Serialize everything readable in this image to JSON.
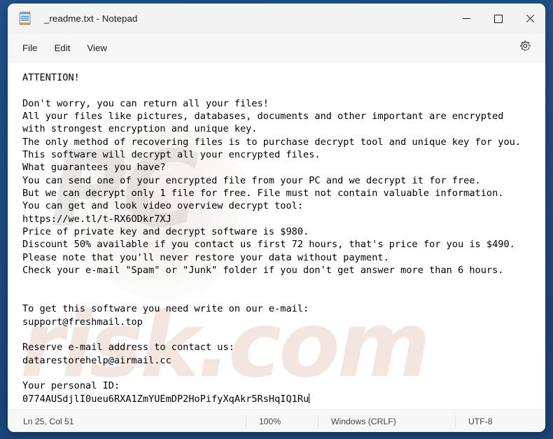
{
  "window": {
    "title": "_readme.txt - Notepad",
    "icon": "notepad-icon",
    "controls": {
      "minimize": "minimize-icon",
      "maximize": "maximize-icon",
      "close": "close-icon"
    }
  },
  "menubar": {
    "items": [
      {
        "label": "File"
      },
      {
        "label": "Edit"
      },
      {
        "label": "View"
      }
    ],
    "settings_icon": "gear-icon"
  },
  "editor": {
    "content": "ATTENTION!\n\nDon't worry, you can return all your files!\nAll your files like pictures, databases, documents and other important are encrypted\nwith strongest encryption and unique key.\nThe only method of recovering files is to purchase decrypt tool and unique key for you.\nThis software will decrypt all your encrypted files.\nWhat guarantees you have?\nYou can send one of your encrypted file from your PC and we decrypt it for free.\nBut we can decrypt only 1 file for free. File must not contain valuable information.\nYou can get and look video overview decrypt tool:\nhttps://we.tl/t-RX6ODkr7XJ\nPrice of private key and decrypt software is $980.\nDiscount 50% available if you contact us first 72 hours, that's price for you is $490.\nPlease note that you'll never restore your data without payment.\nCheck your e-mail \"Spam\" or \"Junk\" folder if you don't get answer more than 6 hours.\n\n\nTo get this software you need write on our e-mail:\nsupport@freshmail.top\n\nReserve e-mail address to contact us:\ndatarestorehelp@airmail.cc\n\nYour personal ID:\n0774AUSdjlI0ueu6RXA1ZmYUEmDP2HoPifyXqAkr5RsHqIQ1Ru",
    "watermark_primary": "PC",
    "watermark_secondary": "risk.com"
  },
  "statusbar": {
    "position": "Ln 25, Col 51",
    "zoom": "100%",
    "line_ending": "Windows (CRLF)",
    "encoding": "UTF-8"
  },
  "colors": {
    "desktop": "#1f4e87",
    "titlebar": "#f3f3f3",
    "editor_bg": "#ffffff",
    "text": "#000000",
    "status_text": "#444444"
  }
}
